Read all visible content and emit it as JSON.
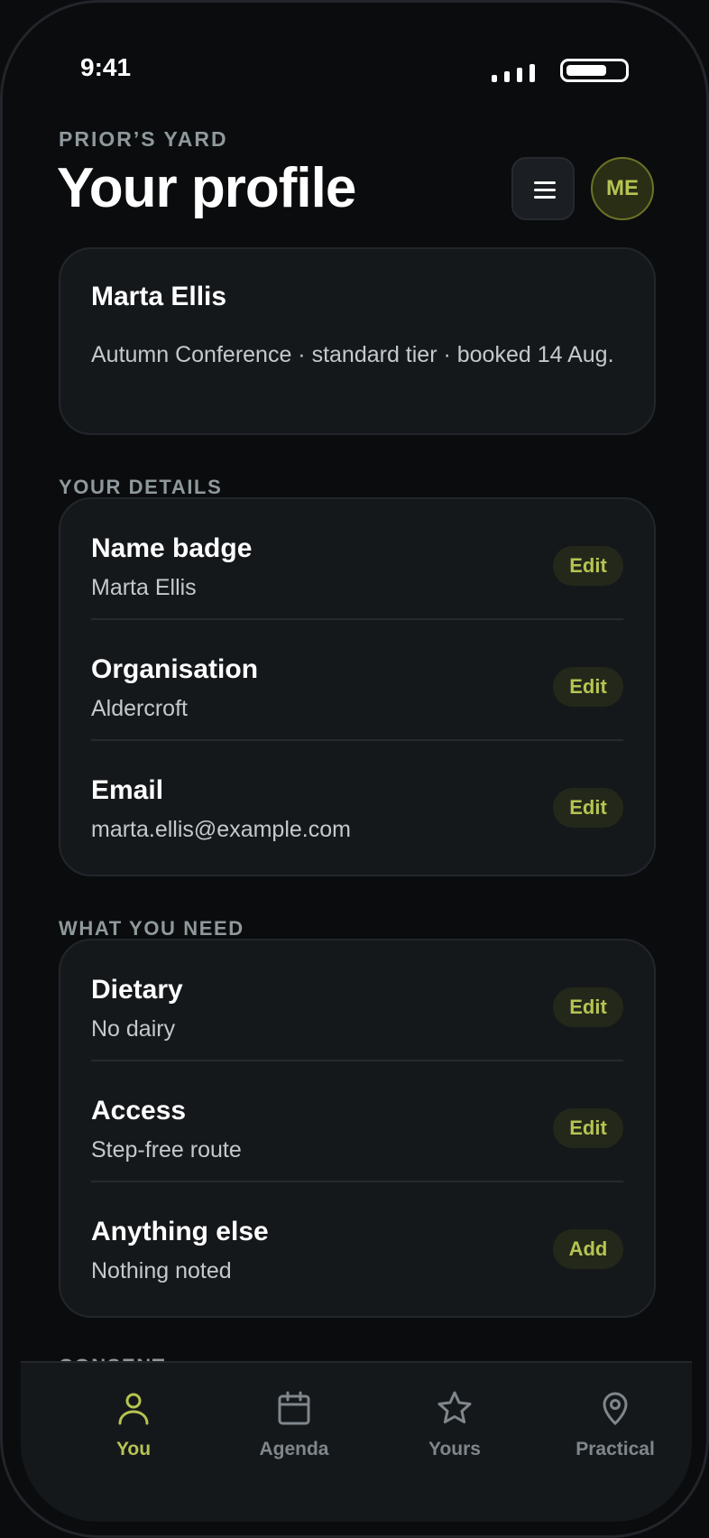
{
  "status_bar": {
    "time": "9:41"
  },
  "header": {
    "eyebrow": "PRIOR’S YARD",
    "title": "Your profile",
    "avatar_initials": "ME"
  },
  "summary": {
    "name": "Marta Ellis",
    "details": "Autumn Conference · standard tier · booked 14 Aug."
  },
  "sections": {
    "details": {
      "label": "YOUR DETAILS",
      "rows": [
        {
          "label": "Name badge",
          "value": "Marta Ellis",
          "action": "Edit"
        },
        {
          "label": "Organisation",
          "value": "Aldercroft",
          "action": "Edit"
        },
        {
          "label": "Email",
          "value": "marta.ellis@example.com",
          "action": "Edit"
        }
      ]
    },
    "needs": {
      "label": "WHAT YOU NEED",
      "rows": [
        {
          "label": "Dietary",
          "value": "No dairy",
          "action": "Edit"
        },
        {
          "label": "Access",
          "value": "Step-free route",
          "action": "Edit"
        },
        {
          "label": "Anything else",
          "value": "Nothing noted",
          "action": "Add"
        }
      ]
    },
    "consent": {
      "label": "CONSENT"
    }
  },
  "tabs": [
    {
      "label": "You",
      "icon": "person-icon",
      "active": true
    },
    {
      "label": "Agenda",
      "icon": "calendar-icon",
      "active": false
    },
    {
      "label": "Yours",
      "icon": "star-icon",
      "active": false
    },
    {
      "label": "Practical",
      "icon": "map-pin-icon",
      "active": false
    }
  ],
  "colors": {
    "accent": "#b6c452",
    "background": "#0b0c0e",
    "card": "#15181b",
    "muted": "#8f999c"
  }
}
